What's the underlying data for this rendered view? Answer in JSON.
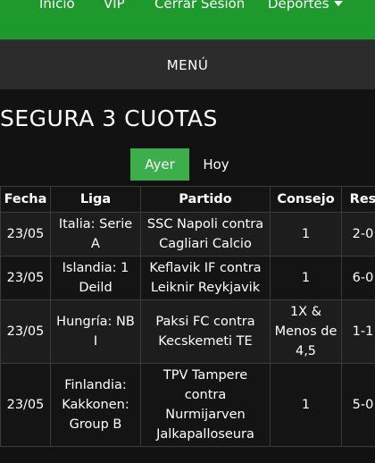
{
  "nav": {
    "items": [
      "Inicio",
      "VIP",
      "Cerrar Sesión",
      "Deportes"
    ]
  },
  "menu": {
    "label": "MENÚ"
  },
  "page": {
    "title": "SEGURA 3 CUOTAS"
  },
  "tabs": [
    {
      "label": "Ayer",
      "active": true
    },
    {
      "label": "Hoy",
      "active": false
    }
  ],
  "table": {
    "headers": [
      "Fecha",
      "Liga",
      "Partido",
      "Consejo",
      "Res"
    ],
    "rows": [
      [
        "23/05",
        "Italia: Serie A",
        "SSC Napoli contra Cagliari Calcio",
        "1",
        "2-0"
      ],
      [
        "23/05",
        "Islandia: 1 Deild",
        "Keflavik IF contra Leiknir Reykjavik",
        "1",
        "6-0"
      ],
      [
        "23/05",
        "Hungría: NB I",
        "Paksi FC contra Kecskemeti TE",
        "1X & Menos de 4,5",
        "1-1"
      ],
      [
        "23/05",
        "Finlandia: Kakkonen: Group B",
        "TPV Tampere contra Nurmijarven Jalkapalloseura",
        "1",
        "5-0"
      ]
    ]
  },
  "colors": {
    "nav_bg": "#1e9a2c",
    "active_tab": "#3cae4c",
    "menu_bg": "#2c2c2c",
    "page_bg": "#121212"
  }
}
